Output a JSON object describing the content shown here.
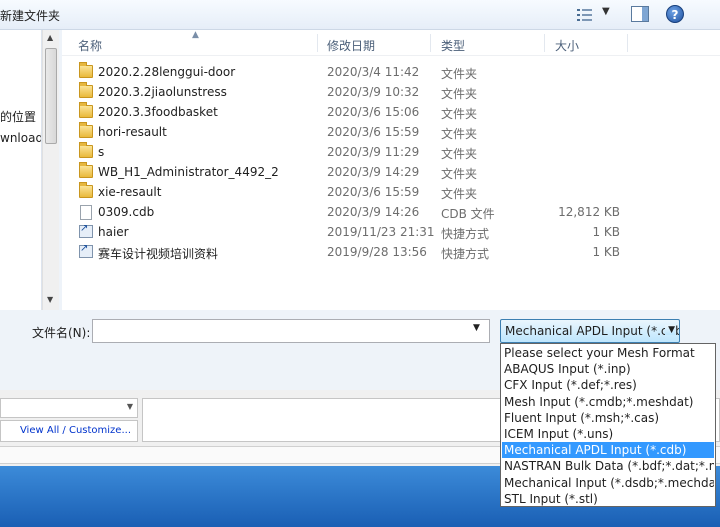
{
  "toolbar": {
    "new_folder": "新建文件夹",
    "help": "?"
  },
  "nav": {
    "items": [
      "的位置",
      "wnloads"
    ]
  },
  "columns": {
    "name": "名称",
    "date": "修改日期",
    "type": "类型",
    "size": "大小"
  },
  "files": [
    {
      "name": "2020.2.28lenggui-door",
      "date": "2020/3/4 11:42",
      "type": "文件夹",
      "size": "",
      "icon": "folder-icon"
    },
    {
      "name": "2020.3.2jiaolunstress",
      "date": "2020/3/9 10:32",
      "type": "文件夹",
      "size": "",
      "icon": "folder-icon"
    },
    {
      "name": "2020.3.3foodbasket",
      "date": "2020/3/6 15:06",
      "type": "文件夹",
      "size": "",
      "icon": "folder-icon"
    },
    {
      "name": "hori-resault",
      "date": "2020/3/6 15:59",
      "type": "文件夹",
      "size": "",
      "icon": "folder-icon"
    },
    {
      "name": "s",
      "date": "2020/3/9 11:29",
      "type": "文件夹",
      "size": "",
      "icon": "folder-icon"
    },
    {
      "name": "WB_H1_Administrator_4492_2",
      "date": "2020/3/9 14:29",
      "type": "文件夹",
      "size": "",
      "icon": "folder-icon"
    },
    {
      "name": "xie-resault",
      "date": "2020/3/6 15:59",
      "type": "文件夹",
      "size": "",
      "icon": "folder-icon"
    },
    {
      "name": "0309.cdb",
      "date": "2020/3/9 14:26",
      "type": "CDB 文件",
      "size": "12,812 KB",
      "icon": "file-icon"
    },
    {
      "name": "haier",
      "date": "2019/11/23 21:31",
      "type": "快捷方式",
      "size": "1 KB",
      "icon": "shortcut-icon"
    },
    {
      "name": "赛车设计视频培训资料",
      "date": "2019/9/28 13:56",
      "type": "快捷方式",
      "size": "1 KB",
      "icon": "shortcut-icon"
    }
  ],
  "filename": {
    "label": "文件名(N):",
    "value": ""
  },
  "format": {
    "selected": "Mechanical APDL Input (*.cdb)",
    "options": [
      "Please select your Mesh Format",
      "ABAQUS Input (*.inp)",
      "CFX Input (*.def;*.res)",
      "Mesh Input (*.cmdb;*.meshdat)",
      "Fluent Input (*.msh;*.cas)",
      "ICEM Input (*.uns)",
      "Mechanical APDL Input (*.cdb)",
      "NASTRAN Bulk Data (*.bdf;*.dat;*.nas)",
      "Mechanical Input (*.dsdb;*.mechdat)",
      "STL Input (*.stl)"
    ],
    "highlighted_index": 6
  },
  "lower": {
    "view_all": "View All / Customize..."
  },
  "colors": {
    "selection": "#3399ff",
    "link": "#0033cc"
  }
}
